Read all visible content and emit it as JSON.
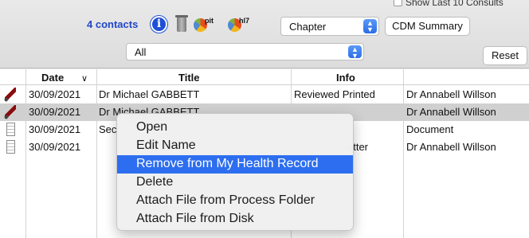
{
  "toolbar": {
    "show_last": "Show Last 10 Consults",
    "contacts_label": "4 contacts",
    "info_icon_glyph": "i",
    "pit_label": "pit",
    "hl7_label": "hl7",
    "chapter_select": "Chapter",
    "cdm_summary_button": "CDM Summary",
    "filter_select": "All",
    "reset_button": "Reset"
  },
  "table": {
    "columns": [
      "Date",
      "Title",
      "Info",
      ""
    ],
    "sort_indicator": "∨",
    "rows": [
      {
        "icon": "quill-icon",
        "date": "30/09/2021",
        "title": "Dr Michael GABBETT",
        "info": "Reviewed Printed",
        "author": "Dr Annabell Willson"
      },
      {
        "icon": "quill-icon",
        "date": "30/09/2021",
        "title": "Dr Michael GABBETT",
        "info": "",
        "author": "Dr Annabell Willson"
      },
      {
        "icon": "document-icon",
        "date": "30/09/2021",
        "title": "Sec",
        "info": "",
        "author": "Document"
      },
      {
        "icon": "document-icon",
        "date": "30/09/2021",
        "title": "",
        "info": "etter",
        "author": "Dr Annabell Willson"
      }
    ]
  },
  "context_menu": {
    "items": [
      "Open",
      "Edit Name",
      "Remove from My Health Record",
      "Delete",
      "Attach File from Process Folder",
      "Attach File from Disk"
    ],
    "highlighted_index": 2
  },
  "colors": {
    "accent_blue": "#2046c9",
    "menu_highlight": "#2d6ef0",
    "selected_row": "#d0d0d0"
  }
}
